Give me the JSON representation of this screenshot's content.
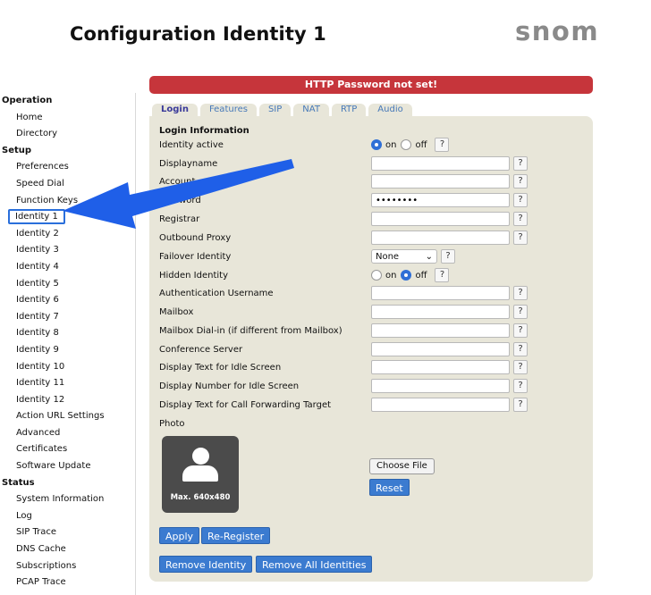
{
  "header": {
    "title": "Configuration Identity 1",
    "logo": "snom"
  },
  "sidebar": {
    "groups": [
      {
        "label": "Operation",
        "items": [
          "Home",
          "Directory"
        ]
      },
      {
        "label": "Setup",
        "items": [
          "Preferences",
          "Speed Dial",
          "Function Keys",
          "Identity 1",
          "Identity 2",
          "Identity 3",
          "Identity 4",
          "Identity 5",
          "Identity 6",
          "Identity 7",
          "Identity 8",
          "Identity 9",
          "Identity 10",
          "Identity 11",
          "Identity 12",
          "Action URL Settings",
          "Advanced",
          "Certificates",
          "Software Update"
        ]
      },
      {
        "label": "Status",
        "items": [
          "System Information",
          "Log",
          "SIP Trace",
          "DNS Cache",
          "Subscriptions",
          "PCAP Trace"
        ]
      }
    ],
    "active_item": "Identity 1"
  },
  "banner": {
    "text": "HTTP Password not set!",
    "color": "#c6353b"
  },
  "tabs": [
    "Login",
    "Features",
    "SIP",
    "NAT",
    "RTP",
    "Audio"
  ],
  "active_tab": "Login",
  "form": {
    "section_title": "Login Information",
    "help_label": "?",
    "on_label": "on",
    "off_label": "off",
    "fields": {
      "identity_active": {
        "label": "Identity active",
        "value": "on"
      },
      "displayname": {
        "label": "Displayname",
        "value": ""
      },
      "account": {
        "label": "Account",
        "value": ""
      },
      "password": {
        "label": "Password",
        "value": "••••••••"
      },
      "registrar": {
        "label": "Registrar",
        "value": ""
      },
      "outbound_proxy": {
        "label": "Outbound Proxy",
        "value": ""
      },
      "failover_identity": {
        "label": "Failover Identity",
        "value": "None"
      },
      "hidden_identity": {
        "label": "Hidden Identity",
        "value": "off"
      },
      "auth_username": {
        "label": "Authentication Username",
        "value": ""
      },
      "mailbox": {
        "label": "Mailbox",
        "value": ""
      },
      "mailbox_dialin": {
        "label": "Mailbox Dial-in (if different from Mailbox)",
        "value": ""
      },
      "conference_server": {
        "label": "Conference Server",
        "value": ""
      },
      "idle_text": {
        "label": "Display Text for Idle Screen",
        "value": ""
      },
      "idle_number": {
        "label": "Display Number for Idle Screen",
        "value": ""
      },
      "cfwd_text": {
        "label": "Display Text for Call Forwarding Target",
        "value": ""
      },
      "photo": {
        "label": "Photo",
        "placeholder_text": "Max. 640x480"
      }
    }
  },
  "buttons": {
    "choose_file": "Choose File",
    "reset": "Reset",
    "apply": "Apply",
    "re_register": "Re-Register",
    "remove_identity": "Remove Identity",
    "remove_all": "Remove All Identities"
  },
  "colors": {
    "accent": "#3b7bd0",
    "panel": "#e8e6d9",
    "annotation_arrow": "#1f5fe8"
  }
}
